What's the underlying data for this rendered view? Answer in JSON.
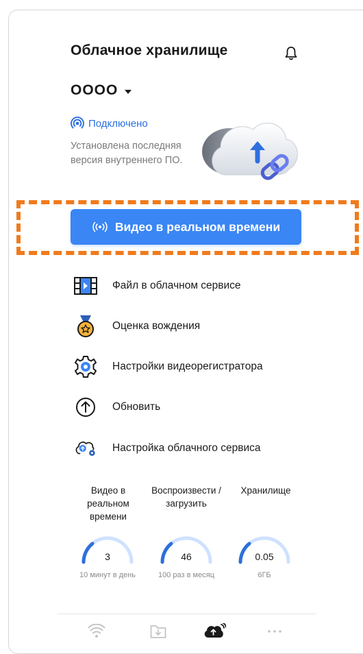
{
  "header": {
    "title": "Облачное хранилище"
  },
  "device": {
    "name": "OOOO"
  },
  "status": {
    "connected": "Подключено",
    "firmware": "Установлена последняя версия внутреннего ПО."
  },
  "live_button": {
    "label": "Видео в реальном времени"
  },
  "menu": [
    {
      "label": "Файл в облачном сервисе",
      "icon": "video-file-icon"
    },
    {
      "label": "Оценка вождения",
      "icon": "medal-icon"
    },
    {
      "label": "Настройки видеорегистратора",
      "icon": "gear-icon"
    },
    {
      "label": "Обновить",
      "icon": "upload-circle-icon"
    },
    {
      "label": "Настройка облачного сервиса",
      "icon": "cloud-settings-icon"
    }
  ],
  "stats": [
    {
      "label": "Видео в реальном времени",
      "value": "3",
      "sub": "10 минут в день"
    },
    {
      "label": "Воспроизвести /загрузить",
      "value": "46",
      "sub": "100 раз в месяц"
    },
    {
      "label": "Хранилище",
      "value": "0.05",
      "sub": "6ГБ"
    }
  ],
  "tabs": [
    {
      "icon": "wifi-icon"
    },
    {
      "icon": "download-folder-icon"
    },
    {
      "icon": "cloud-upload-icon"
    },
    {
      "icon": "more-icon"
    }
  ],
  "colors": {
    "accent": "#3a86f5",
    "highlight": "#f07b1d",
    "gauge": "#2d6fdc",
    "gauge_track": "#cfe1ff"
  }
}
